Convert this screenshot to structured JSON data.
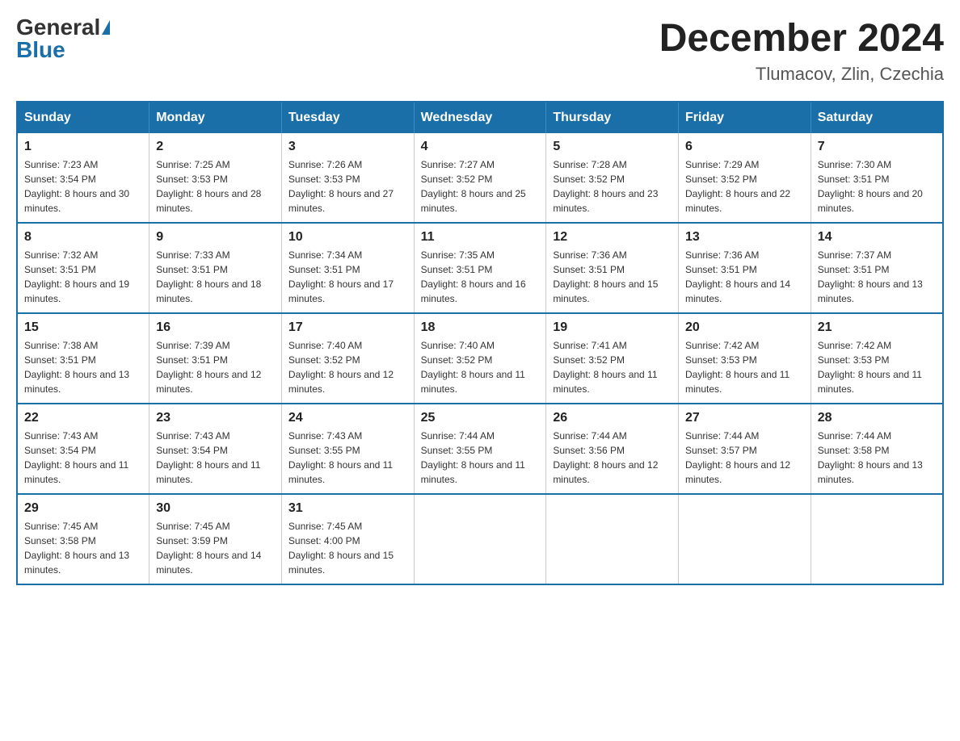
{
  "header": {
    "logo_general": "General",
    "logo_blue": "Blue",
    "month_title": "December 2024",
    "location": "Tlumacov, Zlin, Czechia"
  },
  "days_of_week": [
    "Sunday",
    "Monday",
    "Tuesday",
    "Wednesday",
    "Thursday",
    "Friday",
    "Saturday"
  ],
  "weeks": [
    [
      {
        "day": "1",
        "sunrise": "7:23 AM",
        "sunset": "3:54 PM",
        "daylight": "8 hours and 30 minutes."
      },
      {
        "day": "2",
        "sunrise": "7:25 AM",
        "sunset": "3:53 PM",
        "daylight": "8 hours and 28 minutes."
      },
      {
        "day": "3",
        "sunrise": "7:26 AM",
        "sunset": "3:53 PM",
        "daylight": "8 hours and 27 minutes."
      },
      {
        "day": "4",
        "sunrise": "7:27 AM",
        "sunset": "3:52 PM",
        "daylight": "8 hours and 25 minutes."
      },
      {
        "day": "5",
        "sunrise": "7:28 AM",
        "sunset": "3:52 PM",
        "daylight": "8 hours and 23 minutes."
      },
      {
        "day": "6",
        "sunrise": "7:29 AM",
        "sunset": "3:52 PM",
        "daylight": "8 hours and 22 minutes."
      },
      {
        "day": "7",
        "sunrise": "7:30 AM",
        "sunset": "3:51 PM",
        "daylight": "8 hours and 20 minutes."
      }
    ],
    [
      {
        "day": "8",
        "sunrise": "7:32 AM",
        "sunset": "3:51 PM",
        "daylight": "8 hours and 19 minutes."
      },
      {
        "day": "9",
        "sunrise": "7:33 AM",
        "sunset": "3:51 PM",
        "daylight": "8 hours and 18 minutes."
      },
      {
        "day": "10",
        "sunrise": "7:34 AM",
        "sunset": "3:51 PM",
        "daylight": "8 hours and 17 minutes."
      },
      {
        "day": "11",
        "sunrise": "7:35 AM",
        "sunset": "3:51 PM",
        "daylight": "8 hours and 16 minutes."
      },
      {
        "day": "12",
        "sunrise": "7:36 AM",
        "sunset": "3:51 PM",
        "daylight": "8 hours and 15 minutes."
      },
      {
        "day": "13",
        "sunrise": "7:36 AM",
        "sunset": "3:51 PM",
        "daylight": "8 hours and 14 minutes."
      },
      {
        "day": "14",
        "sunrise": "7:37 AM",
        "sunset": "3:51 PM",
        "daylight": "8 hours and 13 minutes."
      }
    ],
    [
      {
        "day": "15",
        "sunrise": "7:38 AM",
        "sunset": "3:51 PM",
        "daylight": "8 hours and 13 minutes."
      },
      {
        "day": "16",
        "sunrise": "7:39 AM",
        "sunset": "3:51 PM",
        "daylight": "8 hours and 12 minutes."
      },
      {
        "day": "17",
        "sunrise": "7:40 AM",
        "sunset": "3:52 PM",
        "daylight": "8 hours and 12 minutes."
      },
      {
        "day": "18",
        "sunrise": "7:40 AM",
        "sunset": "3:52 PM",
        "daylight": "8 hours and 11 minutes."
      },
      {
        "day": "19",
        "sunrise": "7:41 AM",
        "sunset": "3:52 PM",
        "daylight": "8 hours and 11 minutes."
      },
      {
        "day": "20",
        "sunrise": "7:42 AM",
        "sunset": "3:53 PM",
        "daylight": "8 hours and 11 minutes."
      },
      {
        "day": "21",
        "sunrise": "7:42 AM",
        "sunset": "3:53 PM",
        "daylight": "8 hours and 11 minutes."
      }
    ],
    [
      {
        "day": "22",
        "sunrise": "7:43 AM",
        "sunset": "3:54 PM",
        "daylight": "8 hours and 11 minutes."
      },
      {
        "day": "23",
        "sunrise": "7:43 AM",
        "sunset": "3:54 PM",
        "daylight": "8 hours and 11 minutes."
      },
      {
        "day": "24",
        "sunrise": "7:43 AM",
        "sunset": "3:55 PM",
        "daylight": "8 hours and 11 minutes."
      },
      {
        "day": "25",
        "sunrise": "7:44 AM",
        "sunset": "3:55 PM",
        "daylight": "8 hours and 11 minutes."
      },
      {
        "day": "26",
        "sunrise": "7:44 AM",
        "sunset": "3:56 PM",
        "daylight": "8 hours and 12 minutes."
      },
      {
        "day": "27",
        "sunrise": "7:44 AM",
        "sunset": "3:57 PM",
        "daylight": "8 hours and 12 minutes."
      },
      {
        "day": "28",
        "sunrise": "7:44 AM",
        "sunset": "3:58 PM",
        "daylight": "8 hours and 13 minutes."
      }
    ],
    [
      {
        "day": "29",
        "sunrise": "7:45 AM",
        "sunset": "3:58 PM",
        "daylight": "8 hours and 13 minutes."
      },
      {
        "day": "30",
        "sunrise": "7:45 AM",
        "sunset": "3:59 PM",
        "daylight": "8 hours and 14 minutes."
      },
      {
        "day": "31",
        "sunrise": "7:45 AM",
        "sunset": "4:00 PM",
        "daylight": "8 hours and 15 minutes."
      },
      null,
      null,
      null,
      null
    ]
  ]
}
